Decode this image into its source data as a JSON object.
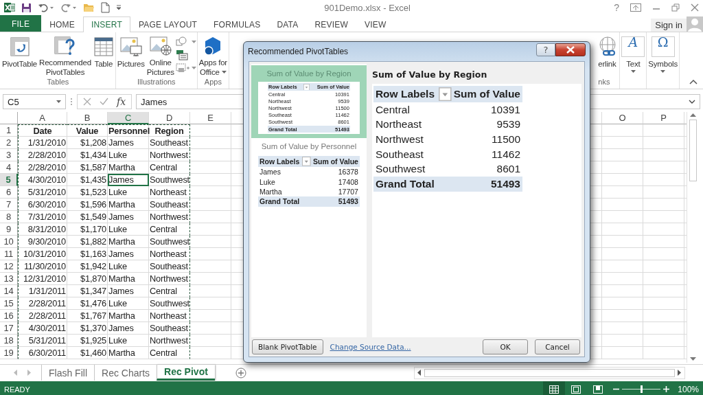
{
  "window": {
    "title": "901Demo.xlsx - Excel",
    "help": "?"
  },
  "ribbon_tabs": [
    {
      "label": "FILE",
      "kind": "file",
      "selected": false
    },
    {
      "label": "HOME",
      "kind": "tab",
      "selected": false
    },
    {
      "label": "INSERT",
      "kind": "tab",
      "selected": true
    },
    {
      "label": "PAGE LAYOUT",
      "kind": "tab",
      "selected": false
    },
    {
      "label": "FORMULAS",
      "kind": "tab",
      "selected": false
    },
    {
      "label": "DATA",
      "kind": "tab",
      "selected": false
    },
    {
      "label": "REVIEW",
      "kind": "tab",
      "selected": false
    },
    {
      "label": "VIEW",
      "kind": "tab",
      "selected": false
    }
  ],
  "account": {
    "label": "Sign in"
  },
  "ribbon_groups": [
    {
      "label": "Tables",
      "buttons": [
        {
          "lines": [
            "PivotTable"
          ],
          "dropdown": false
        },
        {
          "lines": [
            "Recommended",
            "PivotTables"
          ],
          "dropdown": false
        },
        {
          "lines": [
            "Table"
          ],
          "dropdown": false
        }
      ]
    },
    {
      "label": "Illustrations",
      "buttons": [
        {
          "lines": [
            "Pictures"
          ],
          "dropdown": false
        },
        {
          "lines": [
            "Online",
            "Pictures"
          ],
          "dropdown": false
        }
      ],
      "small_buttons": [
        {
          "dropdown": true
        },
        {
          "dropdown": false
        },
        {
          "dropdown": true
        }
      ]
    },
    {
      "label": "Apps",
      "buttons": [
        {
          "lines": [
            "Apps for",
            "Office"
          ],
          "dropdown": true
        }
      ]
    },
    {
      "label": "nks",
      "kind": "partial",
      "buttons": [
        {
          "lines": [
            "erlink"
          ],
          "dropdown": false
        }
      ]
    },
    {
      "kind": "glyph",
      "buttons": [
        {
          "lines": [
            "Text"
          ],
          "glyph": "A",
          "dropdown": true
        }
      ]
    },
    {
      "kind": "glyph",
      "buttons": [
        {
          "lines": [
            "Symbols"
          ],
          "glyph": "Ω",
          "dropdown": true
        }
      ]
    }
  ],
  "formula_bar": {
    "name_box": "C5",
    "fx": "fx",
    "value": "James"
  },
  "sheet": {
    "copy_range": true,
    "columns": [
      {
        "label": "A",
        "selected": false
      },
      {
        "label": "B",
        "selected": false
      },
      {
        "label": "C",
        "selected": true
      },
      {
        "label": "D",
        "selected": false
      },
      {
        "label": "E",
        "selected": false
      }
    ],
    "right_columns": [
      {
        "label": "O",
        "selected": false
      },
      {
        "label": "P",
        "selected": false
      }
    ],
    "rows": [
      {
        "number": "1",
        "kind": "header",
        "selected": false,
        "cells": [
          "Date",
          "Value",
          "Personnel",
          "Region"
        ]
      },
      {
        "number": "2",
        "kind": "data",
        "selected": false,
        "cells": [
          "1/31/2010",
          "$1,208",
          "James",
          "Southeast"
        ]
      },
      {
        "number": "3",
        "kind": "data",
        "selected": false,
        "cells": [
          "2/28/2010",
          "$1,434",
          "Luke",
          "Northwest"
        ]
      },
      {
        "number": "4",
        "kind": "data",
        "selected": false,
        "cells": [
          "2/28/2010",
          "$1,587",
          "Martha",
          "Central"
        ]
      },
      {
        "number": "5",
        "kind": "data",
        "selected": true,
        "cells": [
          "4/30/2010",
          "$1,435",
          "James",
          "Southwest"
        ]
      },
      {
        "number": "6",
        "kind": "data",
        "selected": false,
        "cells": [
          "5/31/2010",
          "$1,523",
          "Luke",
          "Northeast"
        ]
      },
      {
        "number": "7",
        "kind": "data",
        "selected": false,
        "cells": [
          "6/30/2010",
          "$1,596",
          "Martha",
          "Southeast"
        ]
      },
      {
        "number": "8",
        "kind": "data",
        "selected": false,
        "cells": [
          "7/31/2010",
          "$1,549",
          "James",
          "Northwest"
        ]
      },
      {
        "number": "9",
        "kind": "data",
        "selected": false,
        "cells": [
          "8/31/2010",
          "$1,170",
          "Luke",
          "Central"
        ]
      },
      {
        "number": "10",
        "kind": "data",
        "selected": false,
        "cells": [
          "9/30/2010",
          "$1,882",
          "Martha",
          "Southwest"
        ]
      },
      {
        "number": "11",
        "kind": "data",
        "selected": false,
        "cells": [
          "10/31/2010",
          "$1,163",
          "James",
          "Northeast"
        ]
      },
      {
        "number": "12",
        "kind": "data",
        "selected": false,
        "cells": [
          "11/30/2010",
          "$1,942",
          "Luke",
          "Southeast"
        ]
      },
      {
        "number": "13",
        "kind": "data",
        "selected": false,
        "cells": [
          "12/31/2010",
          "$1,870",
          "Martha",
          "Northwest"
        ]
      },
      {
        "number": "14",
        "kind": "data",
        "selected": false,
        "cells": [
          "1/31/2011",
          "$1,347",
          "James",
          "Central"
        ]
      },
      {
        "number": "15",
        "kind": "data",
        "selected": false,
        "cells": [
          "2/28/2011",
          "$1,476",
          "Luke",
          "Southwest"
        ]
      },
      {
        "number": "16",
        "kind": "data",
        "selected": false,
        "cells": [
          "2/28/2011",
          "$1,767",
          "Martha",
          "Northeast"
        ]
      },
      {
        "number": "17",
        "kind": "data",
        "selected": false,
        "cells": [
          "4/30/2011",
          "$1,370",
          "James",
          "Southeast"
        ]
      },
      {
        "number": "18",
        "kind": "data",
        "selected": false,
        "cells": [
          "5/31/2011",
          "$1,925",
          "Luke",
          "Northwest"
        ]
      },
      {
        "number": "19",
        "kind": "data",
        "selected": false,
        "cells": [
          "6/30/2011",
          "$1,460",
          "Martha",
          "Central"
        ]
      }
    ]
  },
  "sheet_tabs": [
    {
      "label": "Flash Fill",
      "selected": false
    },
    {
      "label": "Rec Charts",
      "selected": false
    },
    {
      "label": "Rec Pivot",
      "selected": true
    }
  ],
  "status_bar": {
    "text": "READY",
    "views": [
      {
        "selected": true
      },
      {
        "selected": false
      },
      {
        "selected": false
      }
    ],
    "zoom": {
      "level": 0.5,
      "reading": "100%"
    }
  },
  "dialog": {
    "title": "Recommended PivotTables",
    "help": "?",
    "recommendations": [
      {
        "title": "Sum of Value by Region",
        "selected": true,
        "header": [
          "Row Labels",
          "Sum of Value"
        ],
        "rows": [
          [
            "Central",
            "10391"
          ],
          [
            "Northeast",
            "9539"
          ],
          [
            "Northwest",
            "11500"
          ],
          [
            "Southeast",
            "11462"
          ],
          [
            "Southwest",
            "8601"
          ]
        ],
        "total": [
          "Grand Total",
          "51493"
        ]
      },
      {
        "title": "Sum of Value by Personnel",
        "selected": false,
        "header": [
          "Row Labels",
          "Sum of Value"
        ],
        "rows": [
          [
            "James",
            "16378"
          ],
          [
            "Luke",
            "17408"
          ],
          [
            "Martha",
            "17707"
          ]
        ],
        "total": [
          "Grand Total",
          "51493"
        ]
      }
    ],
    "preview": {
      "title": "Sum of Value by Region",
      "header": [
        "Row Labels",
        "Sum of Value"
      ],
      "rows": [
        [
          "Central",
          "10391"
        ],
        [
          "Northeast",
          "9539"
        ],
        [
          "Northwest",
          "11500"
        ],
        [
          "Southeast",
          "11462"
        ],
        [
          "Southwest",
          "8601"
        ]
      ],
      "total": [
        "Grand Total",
        "51493"
      ]
    },
    "buttons": [
      {
        "label": "Blank PivotTable",
        "kind": "button"
      },
      {
        "label": "Change Source Data...",
        "kind": "link"
      },
      {
        "label": "OK",
        "kind": "button"
      },
      {
        "label": "Cancel",
        "kind": "button"
      }
    ]
  }
}
